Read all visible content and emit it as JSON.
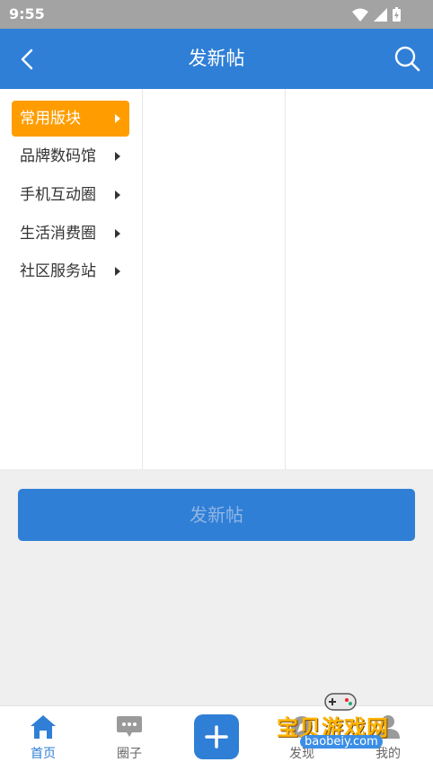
{
  "status_bar": {
    "time": "9:55"
  },
  "header": {
    "title": "发新帖",
    "back_icon": "chevron-left-icon",
    "search_icon": "search-icon"
  },
  "categories": {
    "items": [
      {
        "label": "常用版块",
        "active": true
      },
      {
        "label": "品牌数码馆",
        "active": false
      },
      {
        "label": "手机互动圈",
        "active": false
      },
      {
        "label": "生活消费圈",
        "active": false
      },
      {
        "label": "社区服务站",
        "active": false
      }
    ]
  },
  "submit": {
    "label": "发新帖"
  },
  "tabbar": {
    "items": [
      {
        "label": "首页",
        "icon": "home-icon",
        "active": true
      },
      {
        "label": "圈子",
        "icon": "chat-bubble-icon",
        "active": false
      },
      {
        "label": "",
        "icon": "plus-icon",
        "active": false
      },
      {
        "label": "发现",
        "icon": "discover-icon",
        "active": false
      },
      {
        "label": "我的",
        "icon": "user-icon",
        "active": false
      }
    ]
  },
  "watermark": {
    "text": "宝贝游戏网",
    "url": "baobeiy.com"
  },
  "colors": {
    "primary": "#2f7fd6",
    "accent": "#ff9d00",
    "status_bar": "#a3a3a3"
  }
}
